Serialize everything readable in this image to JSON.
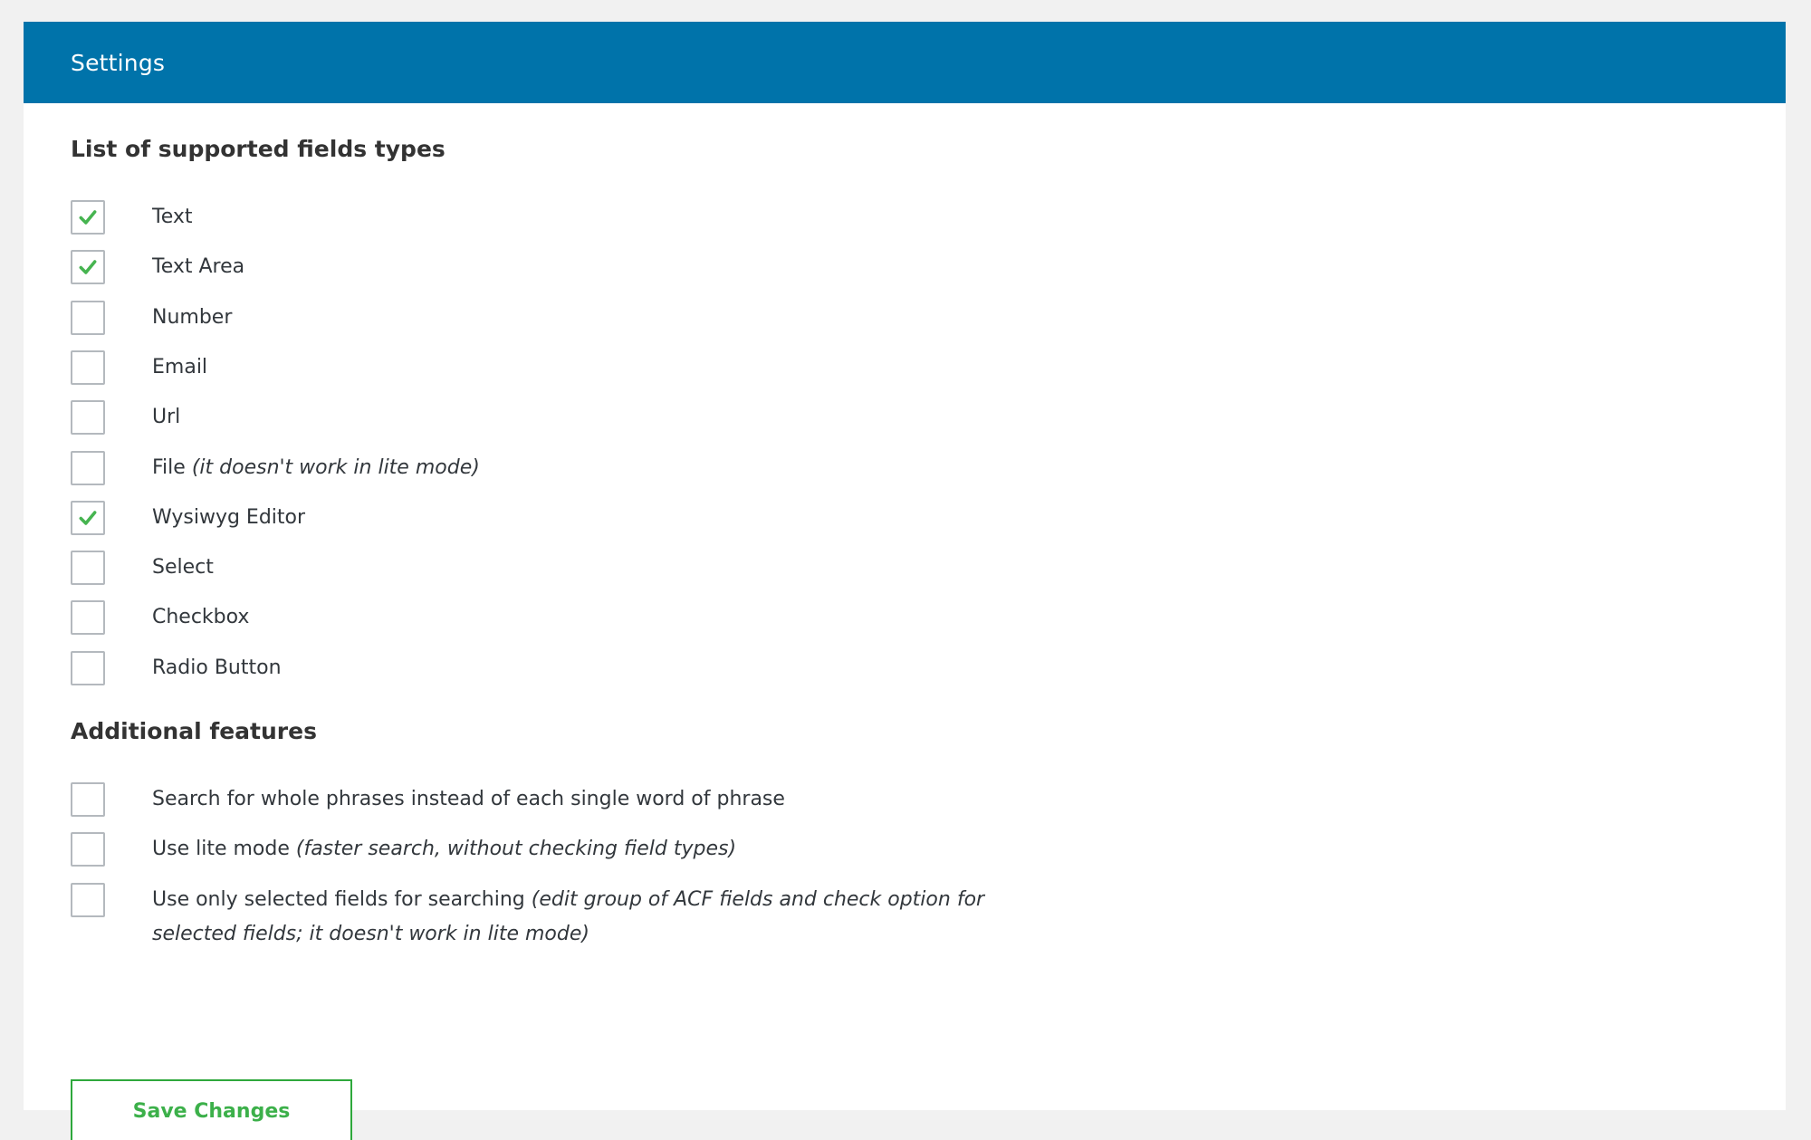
{
  "header": {
    "title": "Settings"
  },
  "colors": {
    "header_bg": "#0073aa",
    "check": "#46b450",
    "button": "#3cb04a",
    "page_bg": "#f1f1f1"
  },
  "field_types": {
    "heading": "List of supported fields types",
    "items": [
      {
        "label": "Text",
        "note": "",
        "checked": true
      },
      {
        "label": "Text Area",
        "note": "",
        "checked": true
      },
      {
        "label": "Number",
        "note": "",
        "checked": false
      },
      {
        "label": "Email",
        "note": "",
        "checked": false
      },
      {
        "label": "Url",
        "note": "",
        "checked": false
      },
      {
        "label": "File",
        "note": "(it doesn't work in lite mode)",
        "checked": false
      },
      {
        "label": "Wysiwyg Editor",
        "note": "",
        "checked": true
      },
      {
        "label": "Select",
        "note": "",
        "checked": false
      },
      {
        "label": "Checkbox",
        "note": "",
        "checked": false
      },
      {
        "label": "Radio Button",
        "note": "",
        "checked": false
      }
    ]
  },
  "additional": {
    "heading": "Additional features",
    "items": [
      {
        "label": "Search for whole phrases instead of each single word of phrase",
        "note": "",
        "checked": false
      },
      {
        "label": "Use lite mode",
        "note": "(faster search, without checking field types)",
        "checked": false
      },
      {
        "label": "Use only selected fields for searching",
        "note": "(edit group of ACF fields and check option for selected fields; it doesn't work in lite mode)",
        "checked": false
      }
    ]
  },
  "actions": {
    "save_label": "Save Changes"
  },
  "icons": {
    "check": "checkmark-icon"
  }
}
